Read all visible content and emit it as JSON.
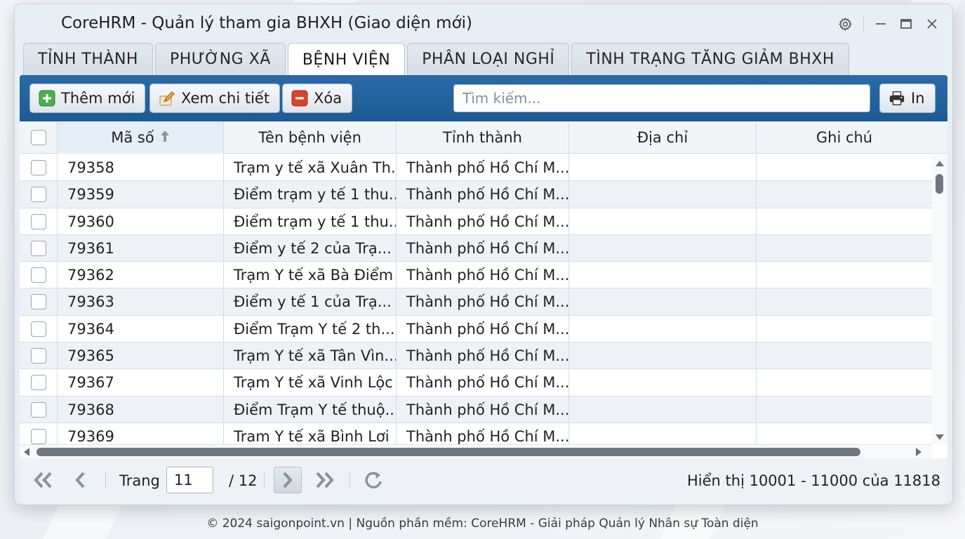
{
  "window": {
    "title": "CoreHRM - Quản lý tham gia BHXH (Giao diện mới)"
  },
  "tabs": [
    {
      "label": "TỈNH THÀNH",
      "active": false
    },
    {
      "label": "PHƯỜNG XÃ",
      "active": false
    },
    {
      "label": "BỆNH VIỆN",
      "active": true
    },
    {
      "label": "PHÂN LOẠI NGHỈ",
      "active": false
    },
    {
      "label": "TÌNH TRẠNG TĂNG GIẢM BHXH",
      "active": false
    }
  ],
  "toolbar": {
    "add_label": "Thêm mới",
    "detail_label": "Xem chi tiết",
    "delete_label": "Xóa",
    "search_placeholder": "Tìm kiếm...",
    "print_label": "In"
  },
  "table": {
    "columns": [
      "Mã số",
      "Tên bệnh viện",
      "Tỉnh thành",
      "Địa chỉ",
      "Ghi chú"
    ],
    "sort_column": "Mã số",
    "sort_direction": "ascending",
    "rows": [
      {
        "id": "79358",
        "name": "Trạm y tế xã Xuân Th...",
        "province": "Thành phố Hồ Chí M...",
        "address": "",
        "note": ""
      },
      {
        "id": "79359",
        "name": "Điểm trạm y tế 1 thu...",
        "province": "Thành phố Hồ Chí M...",
        "address": "",
        "note": ""
      },
      {
        "id": "79360",
        "name": "Điểm trạm y tế 1 thu...",
        "province": "Thành phố Hồ Chí M...",
        "address": "",
        "note": ""
      },
      {
        "id": "79361",
        "name": "Điểm y tế 2 của Trạ...",
        "province": "Thành phố Hồ Chí M...",
        "address": "",
        "note": ""
      },
      {
        "id": "79362",
        "name": "Trạm Y tế xã Bà Điểm",
        "province": "Thành phố Hồ Chí M...",
        "address": "",
        "note": ""
      },
      {
        "id": "79363",
        "name": "Điểm y tế 1 của Trạ...",
        "province": "Thành phố Hồ Chí M...",
        "address": "",
        "note": ""
      },
      {
        "id": "79364",
        "name": "Điểm Trạm Y tế 2 th...",
        "province": "Thành phố Hồ Chí M...",
        "address": "",
        "note": ""
      },
      {
        "id": "79365",
        "name": "Trạm Y tế xã Tân Vìn...",
        "province": "Thành phố Hồ Chí M...",
        "address": "",
        "note": ""
      },
      {
        "id": "79367",
        "name": "Trạm Y tế xã Vinh Lộc",
        "province": "Thành phố Hồ Chí M...",
        "address": "",
        "note": ""
      },
      {
        "id": "79368",
        "name": "Điểm Trạm Y tế thuộ...",
        "province": "Thành phố Hồ Chí M...",
        "address": "",
        "note": ""
      },
      {
        "id": "79369",
        "name": "Tram Y tế xã Bình Lơi",
        "province": "Thành phố Hồ Chí M...",
        "address": "",
        "note": ""
      }
    ]
  },
  "pager": {
    "page_label": "Trang",
    "current_page": "11",
    "total_pages": "/ 12",
    "info": "Hiển thị 10001 - 11000 của 11818"
  },
  "footer": {
    "text": "© 2024 saigonpoint.vn | Nguồn phần mềm: CoreHRM - Giải pháp Quản lý Nhân sự Toàn diện"
  },
  "colors": {
    "accent": "#1f5e99",
    "add_icon": "#4caf50",
    "delete_icon": "#d9442b"
  }
}
